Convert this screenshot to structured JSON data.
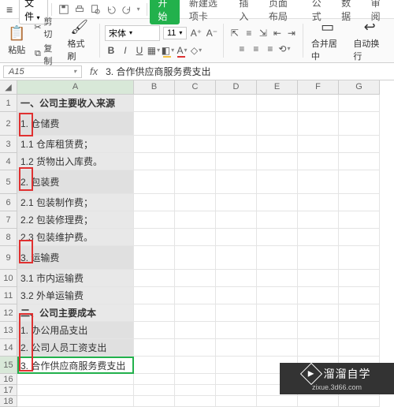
{
  "menubar": {
    "file": "文件",
    "tabs": [
      "开始",
      "新建选项卡",
      "插入",
      "页面布局",
      "公式",
      "数据",
      "审阅"
    ],
    "active_tab_index": 0
  },
  "ribbon": {
    "paste": "粘贴",
    "cut": "剪切",
    "copy": "复制",
    "format_painter": "格式刷",
    "font_name": "宋体",
    "font_size": "11",
    "merge_center": "合并居中",
    "wrap_text": "自动换行"
  },
  "namebox": "A15",
  "formula": "3. 合作供应商服务费支出",
  "columns": [
    "A",
    "B",
    "C",
    "D",
    "E",
    "F",
    "G"
  ],
  "rows": {
    "1": "  一、公司主要收入来源",
    "2": "    1. 仓储费",
    "3": "1.1  仓库租赁费；",
    "4": "1.2  货物出入库费。",
    "5": "    2. 包装费",
    "6": "2.1  包装制作费；",
    "7": "2.2  包装修理费；",
    "8": "2.3  包装维护费。",
    "9": "    3. 运输费",
    "10": "3.1  市内运输费",
    "11": "3.2  外单运输费",
    "12": "  二、公司主要成本",
    "13": "    1. 办公用品支出",
    "14": "    2. 公司人员工资支出",
    "15": "    3. 合作供应商服务费支出",
    "16": "",
    "17": "",
    "18": ""
  },
  "selected_row": "15",
  "watermark": {
    "brand": "溜溜自学",
    "url": "zixue.3d66.com"
  }
}
